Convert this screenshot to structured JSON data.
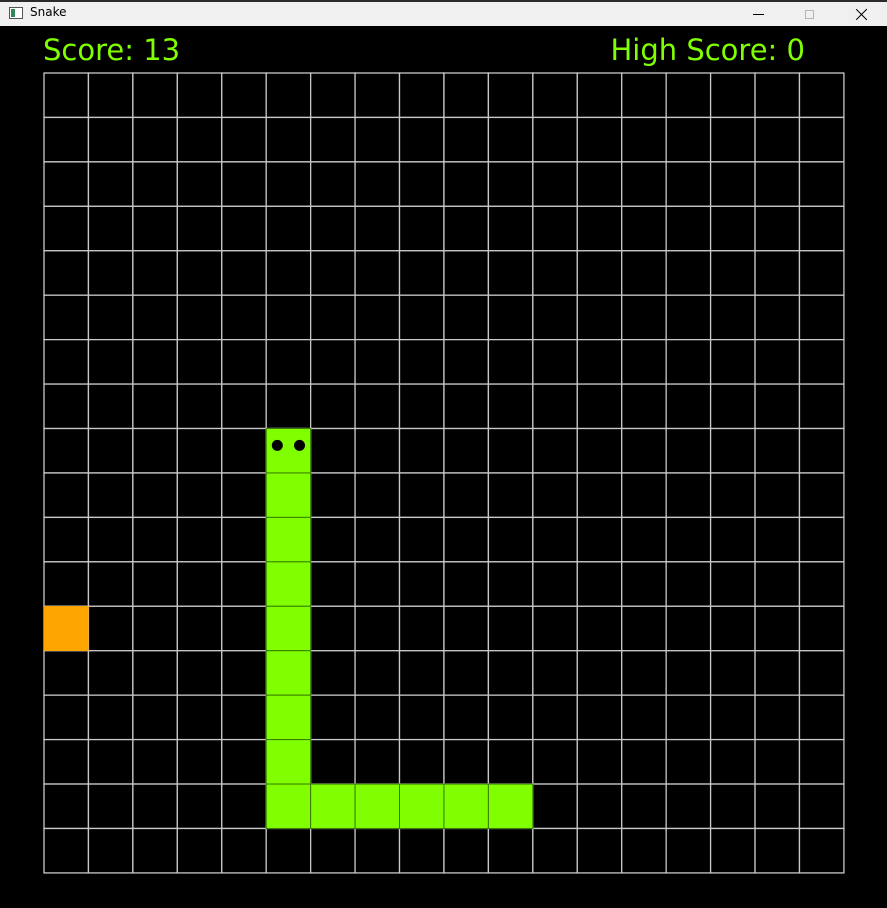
{
  "window": {
    "title": "Snake"
  },
  "hud": {
    "score_text": "Score: 13",
    "high_score_text": "High Score: 0"
  },
  "colors": {
    "background": "#000000",
    "grid_line": "#c8c8c8",
    "snake": "#7fff00",
    "snake_border": "#3a7a00",
    "eye": "#000000",
    "food": "#ffa500",
    "hud_text": "#7fff00"
  },
  "game": {
    "grid_cols": 18,
    "grid_rows": 18,
    "direction": "up",
    "snake": [
      {
        "col": 5,
        "row": 8
      },
      {
        "col": 5,
        "row": 9
      },
      {
        "col": 5,
        "row": 10
      },
      {
        "col": 5,
        "row": 11
      },
      {
        "col": 5,
        "row": 12
      },
      {
        "col": 5,
        "row": 13
      },
      {
        "col": 5,
        "row": 14
      },
      {
        "col": 5,
        "row": 15
      },
      {
        "col": 5,
        "row": 16
      },
      {
        "col": 6,
        "row": 16
      },
      {
        "col": 7,
        "row": 16
      },
      {
        "col": 8,
        "row": 16
      },
      {
        "col": 9,
        "row": 16
      },
      {
        "col": 10,
        "row": 16
      }
    ],
    "food": {
      "col": 0,
      "row": 12
    }
  }
}
